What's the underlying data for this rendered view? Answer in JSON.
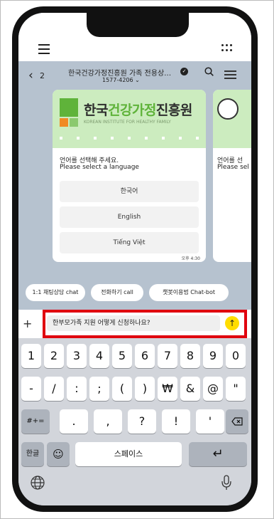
{
  "header": {
    "back_count": "2",
    "room_title": "한국건강가정진흥원 가족 전용상…",
    "room_phone": "1577-4206"
  },
  "card": {
    "logo_kr_main": "한국",
    "logo_kr_accent": "건강가정",
    "logo_kr_end": "진흥원",
    "logo_en": "KOREAN INSTITUTE FOR HEALTHY FAMILY",
    "prompt_kr": "언어를 선택해 주세요.",
    "prompt_en": "Please select a language",
    "languages": [
      "한국어",
      "English",
      "Tiếng Việt"
    ],
    "time": "오후 4:30"
  },
  "card2": {
    "prompt_kr": "언어를 선",
    "prompt_en": "Please sel"
  },
  "chips": [
    "1:1 채팅상담 chat",
    "전화하기 call",
    "챗봇이용법 Chat-bot"
  ],
  "input": {
    "value": "한부모가족 지원 어떻게 신청하나요?"
  },
  "keyboard": {
    "row1": [
      "1",
      "2",
      "3",
      "4",
      "5",
      "6",
      "7",
      "8",
      "9",
      "0"
    ],
    "row2": [
      "-",
      "/",
      ":",
      ";",
      "(",
      ")",
      "₩",
      "&",
      "@",
      "\""
    ],
    "row3_left": "#+=",
    "row3": [
      ".",
      ",",
      "?",
      "!",
      "'"
    ],
    "row4_left": "한글",
    "space": "스페이스"
  },
  "colors": {
    "accent_green": "#5fb33a",
    "accent_orange": "#f08a24",
    "send_yellow": "#ffdd00",
    "highlight_red": "#e0000e"
  }
}
